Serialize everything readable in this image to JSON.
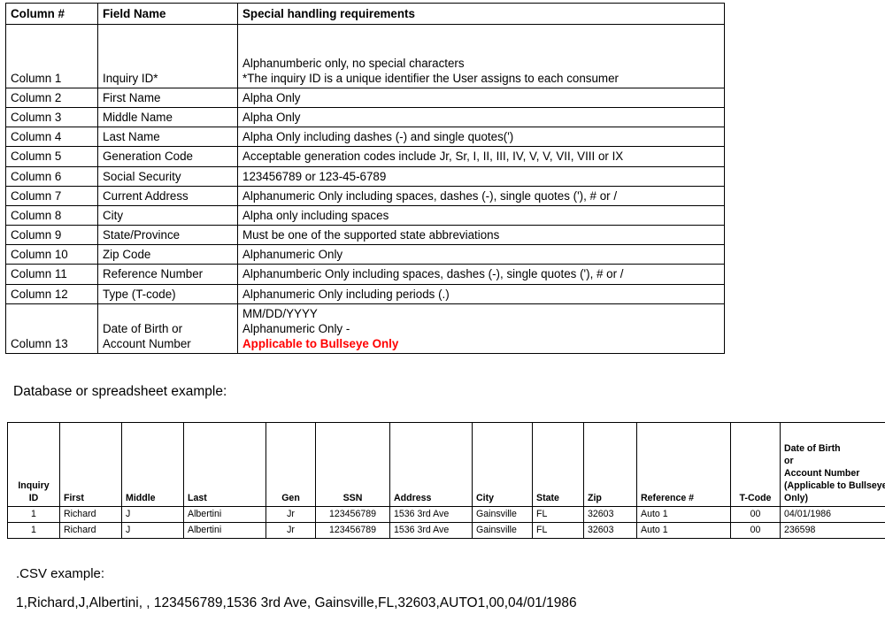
{
  "spec_table": {
    "headers": [
      "Column #",
      "Field Name",
      "Special handling requirements"
    ],
    "rows": [
      {
        "column": "Column 1",
        "field": "Inquiry ID*",
        "req_line1": "Alphanumberic only, no special characters",
        "req_line2": "*The inquiry ID is a unique identifier the User assigns to each consumer"
      },
      {
        "column": "Column 2",
        "field": "First Name",
        "req_line1": "Alpha Only"
      },
      {
        "column": "Column 3",
        "field": "Middle Name",
        "req_line1": "Alpha Only"
      },
      {
        "column": "Column 4",
        "field": "Last Name",
        "req_line1": "Alpha Only including dashes (-) and single quotes(')"
      },
      {
        "column": "Column 5",
        "field": "Generation Code",
        "req_line1": "Acceptable generation codes include Jr, Sr, I, II, III, IV, V, V, VII, VIII or IX"
      },
      {
        "column": "Column 6",
        "field": "Social Security",
        "req_line1": "123456789 or 123-45-6789"
      },
      {
        "column": "Column 7",
        "field": "Current Address",
        "req_line1": "Alphanumeric Only including spaces, dashes (-), single quotes ('), # or /"
      },
      {
        "column": "Column 8",
        "field": "City",
        "req_line1": "Alpha only including spaces"
      },
      {
        "column": "Column 9",
        "field": "State/Province",
        "req_line1": "Must be one of the supported state abbreviations"
      },
      {
        "column": "Column 10",
        "field": "Zip Code",
        "req_line1": "Alphanumeric Only"
      },
      {
        "column": "Column 11",
        "field": "Reference Number",
        "req_line1": "Alphanumberic Only including spaces, dashes (-), single quotes ('), # or /"
      },
      {
        "column": "Column 12",
        "field": "Type (T-code)",
        "req_line1": "Alphanumeric Only including periods (.)"
      },
      {
        "column": "Column 13",
        "field_line1": "Date of Birth or",
        "field_line2": "Account Number",
        "req_line1": "MM/DD/YYYY",
        "req_line2_plain": "Alphanumeric Only - ",
        "req_line2_red": "Applicable to Bullseye Only"
      }
    ]
  },
  "db_caption": "Database or spreadsheet example:",
  "example_table": {
    "headers": [
      {
        "lines": [
          "Inquiry",
          "ID"
        ],
        "align": "center"
      },
      {
        "lines": [
          "First"
        ],
        "align": "left"
      },
      {
        "lines": [
          "Middle"
        ],
        "align": "left"
      },
      {
        "lines": [
          "Last"
        ],
        "align": "left"
      },
      {
        "lines": [
          "Gen"
        ],
        "align": "center"
      },
      {
        "lines": [
          "SSN"
        ],
        "align": "center"
      },
      {
        "lines": [
          "Address"
        ],
        "align": "left"
      },
      {
        "lines": [
          "City"
        ],
        "align": "left"
      },
      {
        "lines": [
          "State"
        ],
        "align": "left"
      },
      {
        "lines": [
          "Zip"
        ],
        "align": "left"
      },
      {
        "lines": [
          "Reference #"
        ],
        "align": "left"
      },
      {
        "lines": [
          "T-Code"
        ],
        "align": "center"
      },
      {
        "lines": [
          "Date of Birth",
          "or",
          "Account Number",
          "(Applicable to Bullseye",
          "Only)"
        ],
        "align": "left"
      }
    ],
    "rows": [
      {
        "cells": [
          "1",
          "Richard",
          "J",
          "Albertini",
          "Jr",
          "123456789",
          "1536 3rd Ave",
          "Gainsville",
          "FL",
          "32603",
          "Auto 1",
          "00",
          "04/01/1986"
        ],
        "aligns": [
          "center",
          "left",
          "left",
          "left",
          "center",
          "center",
          "left",
          "left",
          "left",
          "left",
          "left",
          "center",
          "left"
        ]
      },
      {
        "cells": [
          "1",
          "Richard",
          "J",
          "Albertini",
          "Jr",
          "123456789",
          "1536 3rd Ave",
          "Gainsville",
          "FL",
          "32603",
          "Auto 1",
          "00",
          "236598"
        ],
        "aligns": [
          "center",
          "left",
          "left",
          "left",
          "center",
          "center",
          "left",
          "left",
          "left",
          "left",
          "left",
          "center",
          "left"
        ]
      }
    ]
  },
  "csv_caption": ".CSV example:",
  "csv_line": "1,Richard,J,Albertini, , 123456789,1536 3rd Ave, Gainsville,FL,32603,AUTO1,00,04/01/1986",
  "colors": {
    "accent_red": "#FF0000",
    "border": "#000000",
    "text": "#000000"
  }
}
